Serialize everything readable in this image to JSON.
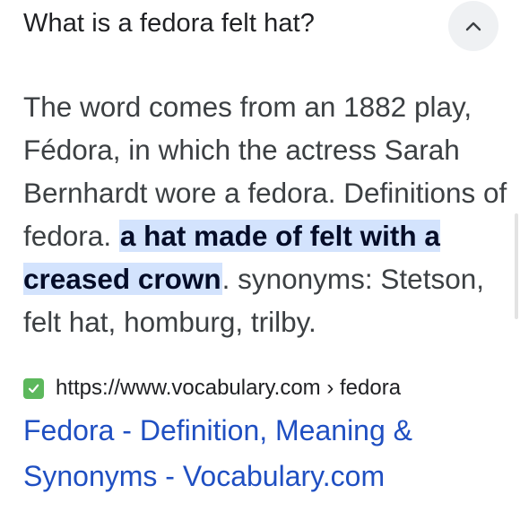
{
  "question": {
    "title": "What is a fedora felt hat?",
    "expanded_icon": "chevron-up-icon"
  },
  "answer": {
    "text_before": "The word comes from an 1882 play, Fédora, in which the actress Sarah Bernhardt wore a fedora. Definitions of fedora. ",
    "highlight": "a hat made of felt with a creased crown",
    "text_after": ". synonyms: Stetson, felt hat, homburg, trilby."
  },
  "source": {
    "favicon": "green-check-favicon",
    "favicon_color": "#5cb85c",
    "url": "https://www.vocabulary.com › fedora"
  },
  "result": {
    "link_title": "Fedora - Definition, Meaning & Synonyms - Vocabulary.com",
    "link_color": "#1f4fc2"
  },
  "colors": {
    "highlight_bg": "#d3e3fd",
    "button_bg": "#eff1f3"
  }
}
